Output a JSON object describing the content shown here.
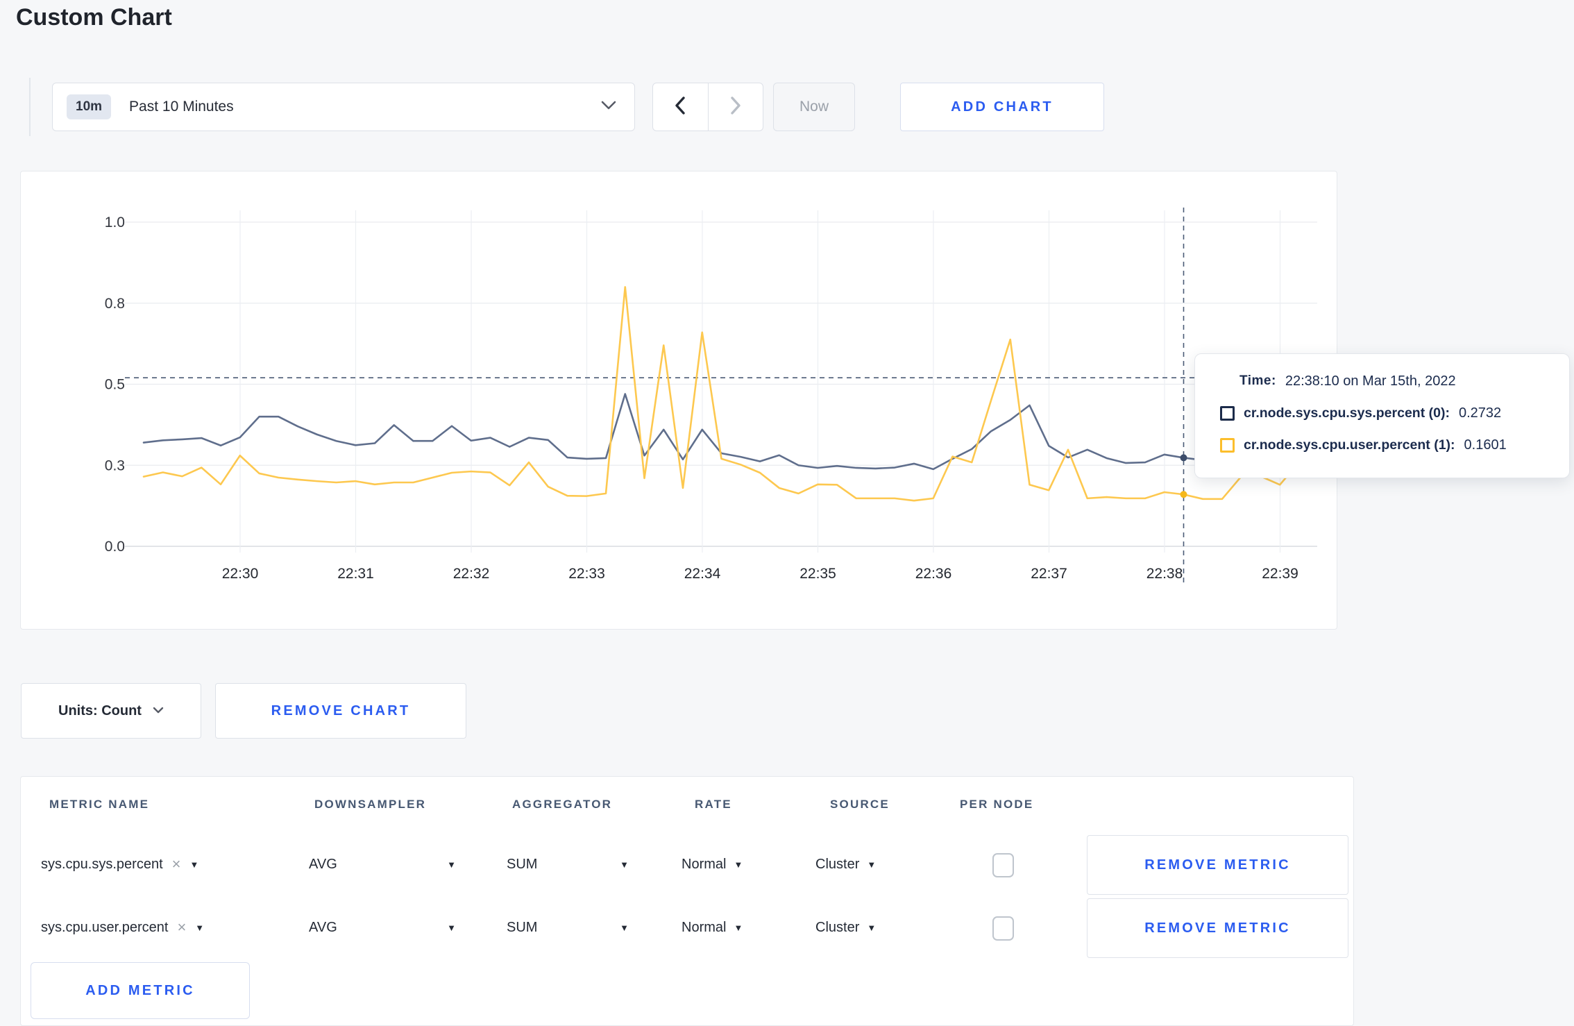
{
  "page": {
    "title": "Custom Chart",
    "background": "#f6f7f9",
    "accent_blue": "#2b5cf0"
  },
  "toolbar": {
    "time_range_badge": "10m",
    "time_range_label": "Past 10 Minutes",
    "now_label": "Now",
    "add_chart_label": "ADD CHART"
  },
  "chart_data": {
    "type": "line",
    "title": "",
    "xlabel": "",
    "ylabel": "",
    "ylim": [
      0,
      1
    ],
    "grid": true,
    "x_start_label": "22:29:10",
    "x_end_label": "22:39:10",
    "interval_seconds": 10,
    "x_ticks": [
      "22:30",
      "22:31",
      "22:32",
      "22:33",
      "22:34",
      "22:35",
      "22:36",
      "22:37",
      "22:38",
      "22:39"
    ],
    "y_ticks": [
      {
        "value": 0,
        "label": "0.0"
      },
      {
        "value": 0.25,
        "label": "0.3"
      },
      {
        "value": 0.5,
        "label": "0.5"
      },
      {
        "value": 0.75,
        "label": "0.8"
      },
      {
        "value": 1,
        "label": "1.0"
      }
    ],
    "series": [
      {
        "name": "cr.node.sys.cpu.sys.percent (0)",
        "color": "#5f6e8c",
        "dot_color": "#3d4d6b",
        "values": [
          0.32,
          0.327,
          0.33,
          0.334,
          0.311,
          0.336,
          0.4,
          0.4,
          0.37,
          0.345,
          0.325,
          0.312,
          0.318,
          0.374,
          0.325,
          0.325,
          0.371,
          0.326,
          0.335,
          0.307,
          0.335,
          0.328,
          0.274,
          0.27,
          0.272,
          0.47,
          0.28,
          0.36,
          0.268,
          0.36,
          0.287,
          0.276,
          0.262,
          0.281,
          0.25,
          0.242,
          0.248,
          0.242,
          0.24,
          0.243,
          0.255,
          0.238,
          0.27,
          0.3,
          0.355,
          0.39,
          0.435,
          0.31,
          0.274,
          0.298,
          0.272,
          0.257,
          0.259,
          0.283,
          0.2732,
          0.266,
          0.295,
          0.3,
          0.298,
          0.296,
          0.302
        ]
      },
      {
        "name": "cr.node.sys.cpu.user.percent (1)",
        "color": "#fdc84f",
        "dot_color": "#f5b81c",
        "values": [
          0.215,
          0.228,
          0.216,
          0.243,
          0.191,
          0.28,
          0.225,
          0.212,
          0.206,
          0.201,
          0.197,
          0.201,
          0.191,
          0.197,
          0.197,
          0.212,
          0.227,
          0.231,
          0.228,
          0.188,
          0.259,
          0.184,
          0.156,
          0.155,
          0.163,
          0.8,
          0.21,
          0.62,
          0.18,
          0.66,
          0.27,
          0.252,
          0.227,
          0.18,
          0.163,
          0.191,
          0.19,
          0.148,
          0.148,
          0.148,
          0.141,
          0.148,
          0.277,
          0.259,
          0.45,
          0.638,
          0.19,
          0.173,
          0.298,
          0.148,
          0.152,
          0.148,
          0.148,
          0.167,
          0.1601,
          0.146,
          0.146,
          0.216,
          0.216,
          0.19,
          0.26
        ]
      }
    ],
    "crosshair": {
      "time": "22:38:10",
      "index": 54,
      "hline_value": 0.52
    }
  },
  "tooltip": {
    "time_label": "Time:",
    "time_value": "22:38:10 on Mar 15th, 2022",
    "rows": [
      {
        "name": "cr.node.sys.cpu.sys.percent (0):",
        "value": "0.2732",
        "color": "#1c2b4a"
      },
      {
        "name": "cr.node.sys.cpu.user.percent (1):",
        "value": "0.1601",
        "color": "#fcbe2c"
      }
    ]
  },
  "chart_footer": {
    "units_label": "Units: Count",
    "remove_chart_label": "REMOVE CHART"
  },
  "metrics_table": {
    "headers": [
      "METRIC NAME",
      "DOWNSAMPLER",
      "AGGREGATOR",
      "RATE",
      "SOURCE",
      "PER NODE"
    ],
    "rows": [
      {
        "metric": "sys.cpu.sys.percent",
        "downsampler": "AVG",
        "aggregator": "SUM",
        "rate": "Normal",
        "source": "Cluster",
        "per_node_checked": false,
        "remove_label": "REMOVE METRIC"
      },
      {
        "metric": "sys.cpu.user.percent",
        "downsampler": "AVG",
        "aggregator": "SUM",
        "rate": "Normal",
        "source": "Cluster",
        "per_node_checked": false,
        "remove_label": "REMOVE METRIC"
      }
    ],
    "add_metric_label": "ADD METRIC"
  }
}
